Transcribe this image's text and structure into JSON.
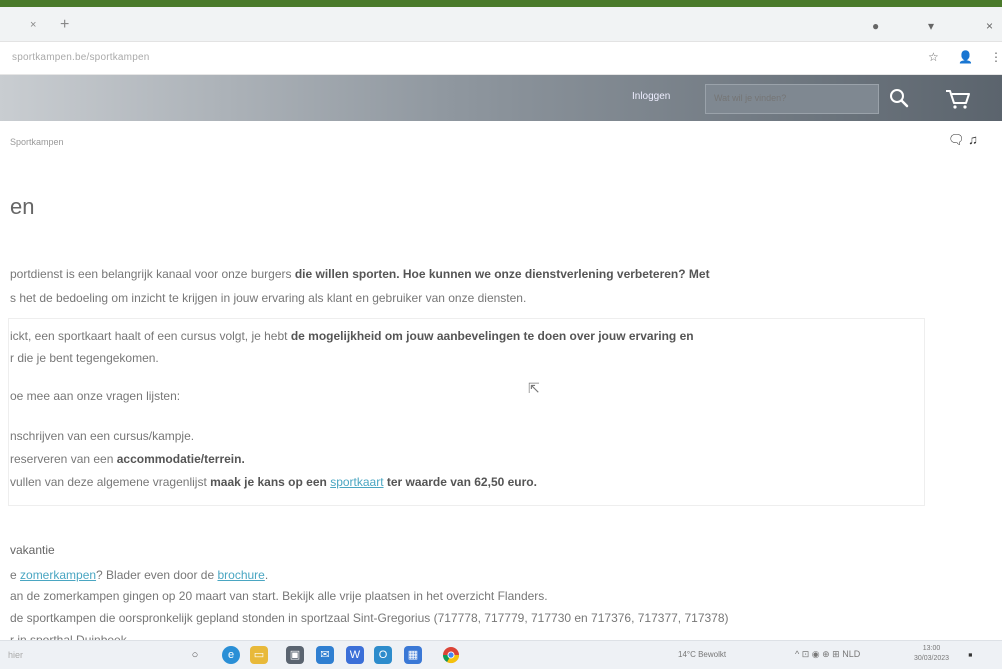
{
  "browser": {
    "tab_close": "×",
    "tab_new": "+",
    "controls": [
      "●",
      "▾",
      "×"
    ],
    "url": "sportkampen.be/sportkampen",
    "star_icon": "☆",
    "profile_icon": "👤",
    "menu_icon": "⋮"
  },
  "header": {
    "login_label": "Inloggen",
    "search_placeholder": "Wat wil je vinden?",
    "colors": {
      "dark": "#5b646d",
      "light": "#c9cdd1"
    }
  },
  "breadcrumb": "Sportkampen",
  "share_icons": "🗨 ♫",
  "page_title": "en",
  "paragraphs": [
    {
      "lines": [
        [
          "portdienst is een belangrijk kanaal voor onze burgers ",
          "die willen sporten. Hoe kunnen we onze dienstverlening verbeteren? Met"
        ],
        [
          "s het de bedoeling om inzicht te krijgen in jouw ervaring als klant en gebruiker van onze diensten.",
          ""
        ]
      ]
    },
    {
      "lines": [
        [
          "ickt, een sportkaart haalt of een cursus volgt, je hebt ",
          "de mogelijkheid om jouw aanbevelingen te doen over jouw ervaring en"
        ],
        [
          "r die je bent tegengekomen.",
          ""
        ]
      ]
    },
    {
      "lines": [
        [
          "oe mee aan onze vragen lijsten:",
          ""
        ]
      ]
    },
    {
      "lines": [
        [
          "nschrijven van een cursus/kampje.",
          ""
        ],
        [
          "reserveren van een ",
          "accommodatie/terrein."
        ]
      ]
    }
  ],
  "survey_line": {
    "pre": "vullen van deze algemene vragenlijst ",
    "bold": "maak je kans op een ",
    "link": "sportkaart",
    "post": " ter waarde van 62,50 euro."
  },
  "section": {
    "title": "vakantie",
    "line1_pre": "e ",
    "line1_link1": "zomerkampen",
    "line1_mid": "? Blader even door de ",
    "line1_link2": "brochure",
    "line1_post": ".",
    "line2": "an de zomerkampen gingen op 20 maart van start. Bekijk alle vrije plaatsen in het overzicht Flanders.",
    "line3": "de sportkampen die oorspronkelijk gepland stonden in sportzaal Sint-Gregorius (717778, 717779, 717730 en 717376, 717377, 717378)",
    "line4": "r in sporthal Duinbeek."
  },
  "taskbar": {
    "search_text": "hier",
    "weather": "14°C  Bewolkt",
    "tray": "^  ⊡  ◉  ⊕  ⊞  NLD",
    "time": "13:00",
    "date": "30/03/2023",
    "notification_icon": "▪"
  }
}
